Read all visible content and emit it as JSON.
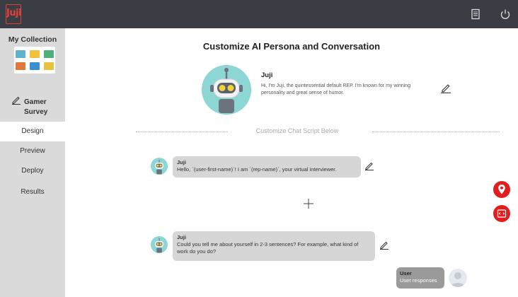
{
  "app": {
    "logo_text": "Juji"
  },
  "sidebar": {
    "collection_title": "My Collection",
    "survey_label": "Gamer Survey",
    "nav": [
      {
        "label": "Design",
        "active": true
      },
      {
        "label": "Preview",
        "active": false
      },
      {
        "label": "Deploy",
        "active": false
      },
      {
        "label": "Results",
        "active": false
      }
    ]
  },
  "main": {
    "title": "Customize AI Persona and Conversation",
    "persona": {
      "name": "Juji",
      "description": "Hi, I'm Juji, the quintessential default REP. I'm known for my winning personality and great sense of humor."
    },
    "script_divider_label": "Customize Chat Script Below",
    "messages": [
      {
        "speaker": "Juji",
        "text": "Hello, `(user-first-name)`! I am `(rep-name)`, your virtual interviewer."
      },
      {
        "speaker": "Juji",
        "text": "Could you tell me about yourself in 2-3 sentences? For example, what kind of work do you do?"
      }
    ],
    "user_message": {
      "speaker": "User",
      "text": "User responses"
    }
  },
  "colors": {
    "topbar": "#3a3d43",
    "brand_red": "#e0413a",
    "sidebar": "#dadada",
    "avatar_teal": "#8cd6d3",
    "fab_red": "#e21d1d"
  },
  "icons": [
    "logo-icon",
    "document-icon",
    "power-icon",
    "pencil-icon",
    "robot-icon",
    "plus-icon",
    "location-pin-icon",
    "code-icon",
    "user-icon"
  ]
}
